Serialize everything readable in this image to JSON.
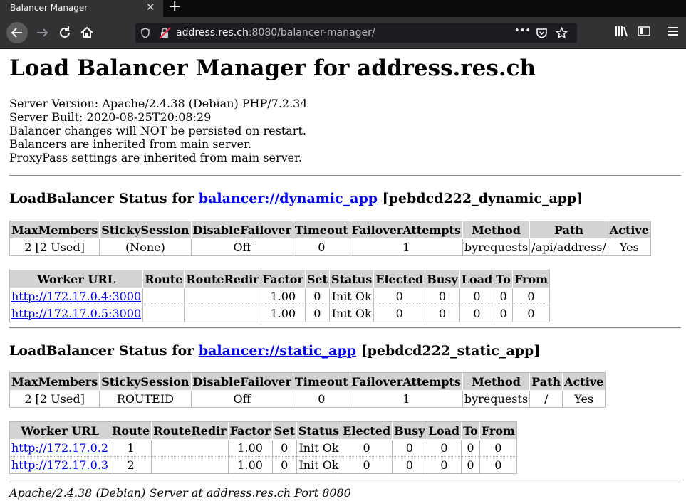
{
  "browser": {
    "tab_title": "Balancer Manager",
    "tab_close": "✕",
    "new_tab": "+",
    "url_host": "address.res.ch",
    "url_rest": ":8080/balancer-manager/",
    "url_more": "•••"
  },
  "page": {
    "title": "Load Balancer Manager for address.res.ch",
    "info_lines": [
      "Server Version: Apache/2.4.38 (Debian) PHP/7.2.34",
      "Server Built: 2020-08-25T20:08:29",
      "Balancer changes will NOT be persisted on restart.",
      "Balancers are inherited from main server.",
      "ProxyPass settings are inherited from main server."
    ],
    "balancer_heading_prefix": "LoadBalancer Status for ",
    "balancer_headers": [
      "MaxMembers",
      "StickySession",
      "DisableFailover",
      "Timeout",
      "FailoverAttempts",
      "Method",
      "Path",
      "Active"
    ],
    "worker_headers_1": [
      "Worker URL",
      "Route",
      "RouteRedir",
      "Factor",
      "Set",
      "Status",
      "Elected",
      "Busy",
      "Load",
      "To",
      "From"
    ],
    "worker_headers_2": [
      "Worker URL",
      "Route",
      "RouteRedir",
      "Factor",
      "Set",
      "Status",
      "Elected",
      "Busy",
      "Load",
      "To",
      "From"
    ],
    "balancers": [
      {
        "link": "balancer://dynamic_app",
        "suffix": " [pebdcd222_dynamic_app]",
        "row": [
          "2 [2 Used]",
          "(None)",
          "Off",
          "0",
          "1",
          "byrequests",
          "/api/address/",
          "Yes"
        ],
        "workers": [
          [
            "http://172.17.0.4:3000",
            "",
            "",
            "1.00",
            "0",
            "Init Ok",
            "0",
            "0",
            "0",
            "0",
            "0"
          ],
          [
            "http://172.17.0.5:3000",
            "",
            "",
            "1.00",
            "0",
            "Init Ok",
            "0",
            "0",
            "0",
            "0",
            "0"
          ]
        ]
      },
      {
        "link": "balancer://static_app",
        "suffix": " [pebdcd222_static_app]",
        "row": [
          "2 [2 Used]",
          "ROUTEID",
          "Off",
          "0",
          "1",
          "byrequests",
          "/",
          "Yes"
        ],
        "workers": [
          [
            "http://172.17.0.2",
            "1",
            "",
            "1.00",
            "0",
            "Init Ok",
            "0",
            "0",
            "0",
            "0",
            "0"
          ],
          [
            "http://172.17.0.3",
            "2",
            "",
            "1.00",
            "0",
            "Init Ok",
            "0",
            "0",
            "0",
            "0",
            "0"
          ]
        ]
      }
    ],
    "footer": "Apache/2.4.38 (Debian) Server at address.res.ch Port 8080"
  }
}
